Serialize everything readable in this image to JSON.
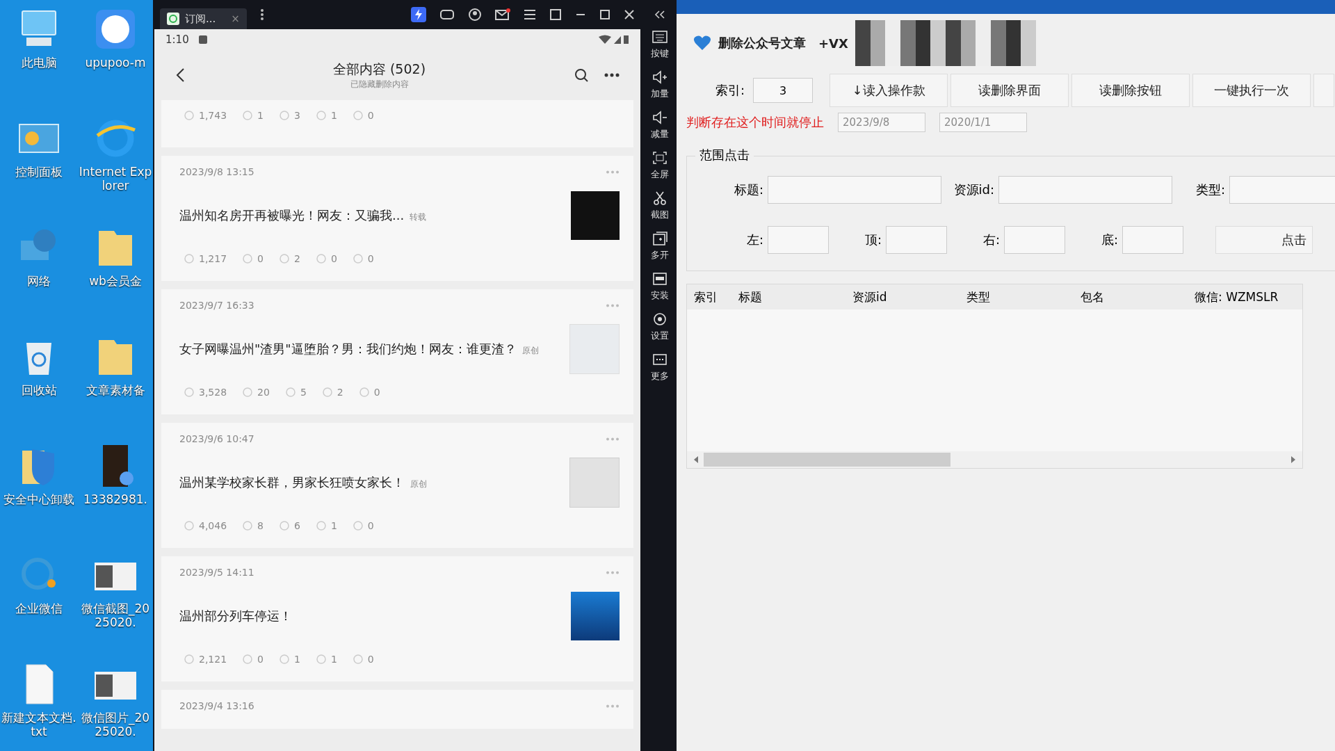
{
  "desktop": {
    "icons": [
      {
        "label": "此电脑",
        "kind": "computer"
      },
      {
        "label": "upupoo-m",
        "kind": "app"
      },
      {
        "label": "控制面板",
        "kind": "panel"
      },
      {
        "label": "Internet Explorer",
        "kind": "browser"
      },
      {
        "label": "网络",
        "kind": "network"
      },
      {
        "label": "wb会员金",
        "kind": "folder"
      },
      {
        "label": "回收站",
        "kind": "bin"
      },
      {
        "label": "文章素材备",
        "kind": "folder"
      },
      {
        "label": "安全中心卸载",
        "kind": "shield"
      },
      {
        "label": "13382981.",
        "kind": "video"
      },
      {
        "label": "企业微信",
        "kind": "wecom"
      },
      {
        "label": "微信截图_2025020.",
        "kind": "image"
      },
      {
        "label": "新建文本文档.txt",
        "kind": "file"
      },
      {
        "label": "微信图片_2025020.",
        "kind": "image"
      }
    ]
  },
  "emulator": {
    "tab": {
      "label": "订阅...",
      "close": "×"
    },
    "phone": {
      "time": "1:10",
      "title": "全部内容 (502)",
      "subtitle": "已隐藏删除内容",
      "partial_stats": [
        "1,743",
        "1",
        "3",
        "1",
        "0"
      ],
      "articles": [
        {
          "date": "2023/9/8 13:15",
          "title": "温州知名房开再被曝光！网友：又骗我...",
          "tag": "转载",
          "thumb": {
            "kind": "dark"
          },
          "stats": [
            "1,217",
            "0",
            "2",
            "0",
            "0"
          ]
        },
        {
          "date": "2023/9/7 16:33",
          "title": "女子网曝温州\"渣男\"逼堕胎？男：我们约炮！网友：谁更渣？",
          "tag": "原创",
          "thumb": {
            "kind": "list"
          },
          "stats": [
            "3,528",
            "20",
            "5",
            "2",
            "0"
          ]
        },
        {
          "date": "2023/9/6 10:47",
          "title": "温州某学校家长群，男家长狂喷女家长！",
          "tag": "原创",
          "thumb": {
            "kind": "light"
          },
          "stats": [
            "4,046",
            "8",
            "6",
            "1",
            "0"
          ]
        },
        {
          "date": "2023/9/5 14:11",
          "title": "温州部分列车停运！",
          "thumb": {
            "kind": "blue"
          },
          "stats": [
            "2,121",
            "0",
            "1",
            "1",
            "0"
          ]
        },
        {
          "date": "2023/9/4 13:16"
        }
      ]
    }
  },
  "side_toolbar": {
    "items": [
      {
        "label": "按键",
        "kind": "keyboard"
      },
      {
        "label": "加量",
        "kind": "volume-up"
      },
      {
        "label": "减量",
        "kind": "volume-down"
      },
      {
        "label": "全屏",
        "kind": "fullscreen"
      },
      {
        "label": "截图",
        "kind": "scissors"
      },
      {
        "label": "多开",
        "kind": "multi"
      },
      {
        "label": "安装",
        "kind": "apk"
      },
      {
        "label": "设置",
        "kind": "settings"
      },
      {
        "label": "更多",
        "kind": "more"
      }
    ]
  },
  "tool": {
    "title": "删除公众号文章",
    "title_suffix": "+VX",
    "index_label": "索引:",
    "index_value": "3",
    "buttons": [
      "↓读入操作款",
      "读删除界面",
      "读删除按钮",
      "一键执行一次"
    ],
    "stop_hint": "判断存在这个时间就停止",
    "dates": [
      "2023/9/8",
      "2020/1/1"
    ],
    "range_group": {
      "legend": "范围点击",
      "fields": [
        {
          "label": "标题:"
        },
        {
          "label": "资源id:"
        },
        {
          "label": "类型:"
        }
      ],
      "bounds": [
        {
          "label": "左:"
        },
        {
          "label": "顶:"
        },
        {
          "label": "右:"
        },
        {
          "label": "底:"
        }
      ],
      "button": "点击"
    },
    "table": {
      "columns": [
        "索引",
        "标题",
        "资源id",
        "类型",
        "包名",
        "微信: WZMSLR"
      ]
    }
  }
}
